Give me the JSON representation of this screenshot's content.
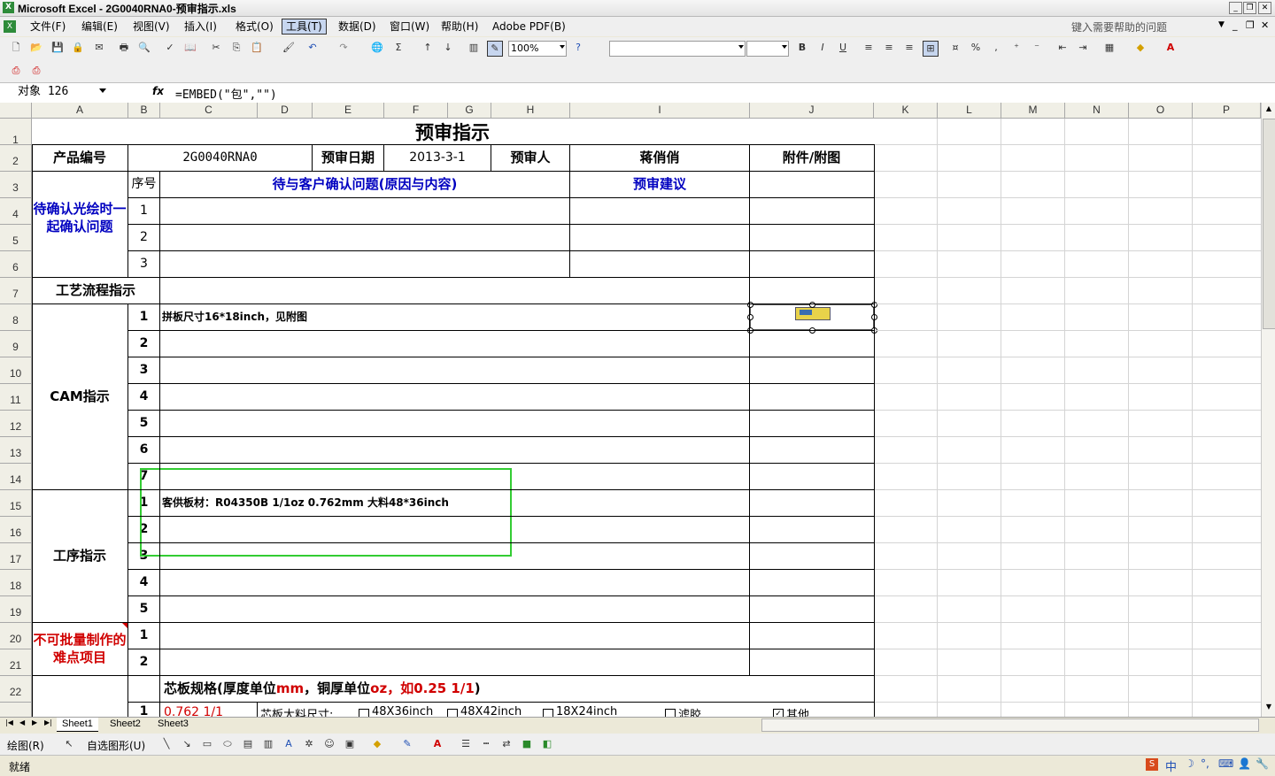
{
  "window": {
    "title": "Microsoft Excel - 2G0040RNA0-预审指示.xls"
  },
  "menu": [
    "文件(F)",
    "编辑(E)",
    "视图(V)",
    "插入(I)",
    "格式(O)",
    "工具(T)",
    "数据(D)",
    "窗口(W)",
    "帮助(H)",
    "Adobe PDF(B)"
  ],
  "help_placeholder": "键入需要帮助的问题",
  "zoom": "100%",
  "namebox": "对象 126",
  "formula": "=EMBED(\"包\",\"\")",
  "columns": [
    "A",
    "B",
    "C",
    "D",
    "E",
    "F",
    "G",
    "H",
    "I",
    "J",
    "K",
    "L",
    "M",
    "N",
    "O",
    "P"
  ],
  "rows": [
    "1",
    "2",
    "3",
    "4",
    "5",
    "6",
    "7",
    "8",
    "9",
    "10",
    "11",
    "12",
    "13",
    "14",
    "15",
    "16",
    "17",
    "18",
    "19",
    "20",
    "21",
    "22"
  ],
  "sheet": {
    "title": "预审指示",
    "r2": {
      "a": "产品编号",
      "c": "2G0040RNA0",
      "e": "预审日期",
      "f": "2013-3-1",
      "h": "预审人",
      "i": "蒋俏俏",
      "j": "附件/附图"
    },
    "r3": {
      "b": "序号",
      "c": "待与客户确认问题(原因与内容)",
      "i": "预审建议"
    },
    "confirm_label": "待确认光绘时一起确认问题",
    "confirm_nums": [
      "1",
      "2",
      "3"
    ],
    "process_label": "工艺流程指示",
    "cam_label": "CAM指示",
    "cam_nums": [
      "1",
      "2",
      "3",
      "4",
      "5",
      "6",
      "7"
    ],
    "cam_text1": "拼板尺寸16*18inch，见附图",
    "proc_label": "工序指示",
    "proc_nums": [
      "1",
      "2",
      "3",
      "4",
      "5"
    ],
    "proc_text1": "客供板材：R04350B  1/1oz  0.762mm 大料48*36inch",
    "hard_label": "不可批量制作的难点项目",
    "hard_nums": [
      "1",
      "2"
    ],
    "core_a": "芯板规格(厚度单位",
    "core_b": "mm",
    "core_c": "，铜厚单位",
    "core_d": "oz",
    "core_e": "，如0.25 1/1",
    "core_f": ")",
    "r23_b": "1",
    "r23_c": "0.762 1/1",
    "r23_d": "芯板大料尺寸:",
    "r23_e": "48X36inch",
    "r23_f": "48X42inch",
    "r23_g": "18X24inch",
    "r23_h": "滤胶",
    "r23_i": "其他"
  },
  "sheet_tabs": [
    "Sheet1",
    "Sheet2",
    "Sheet3"
  ],
  "draw_toolbar": {
    "draw": "绘图(R)",
    "autoshape": "自选图形(U)"
  },
  "status": "就绪",
  "colors": {
    "blue_label": "#0000c0",
    "red_label": "#d00000",
    "highlight": "#33cc33"
  }
}
